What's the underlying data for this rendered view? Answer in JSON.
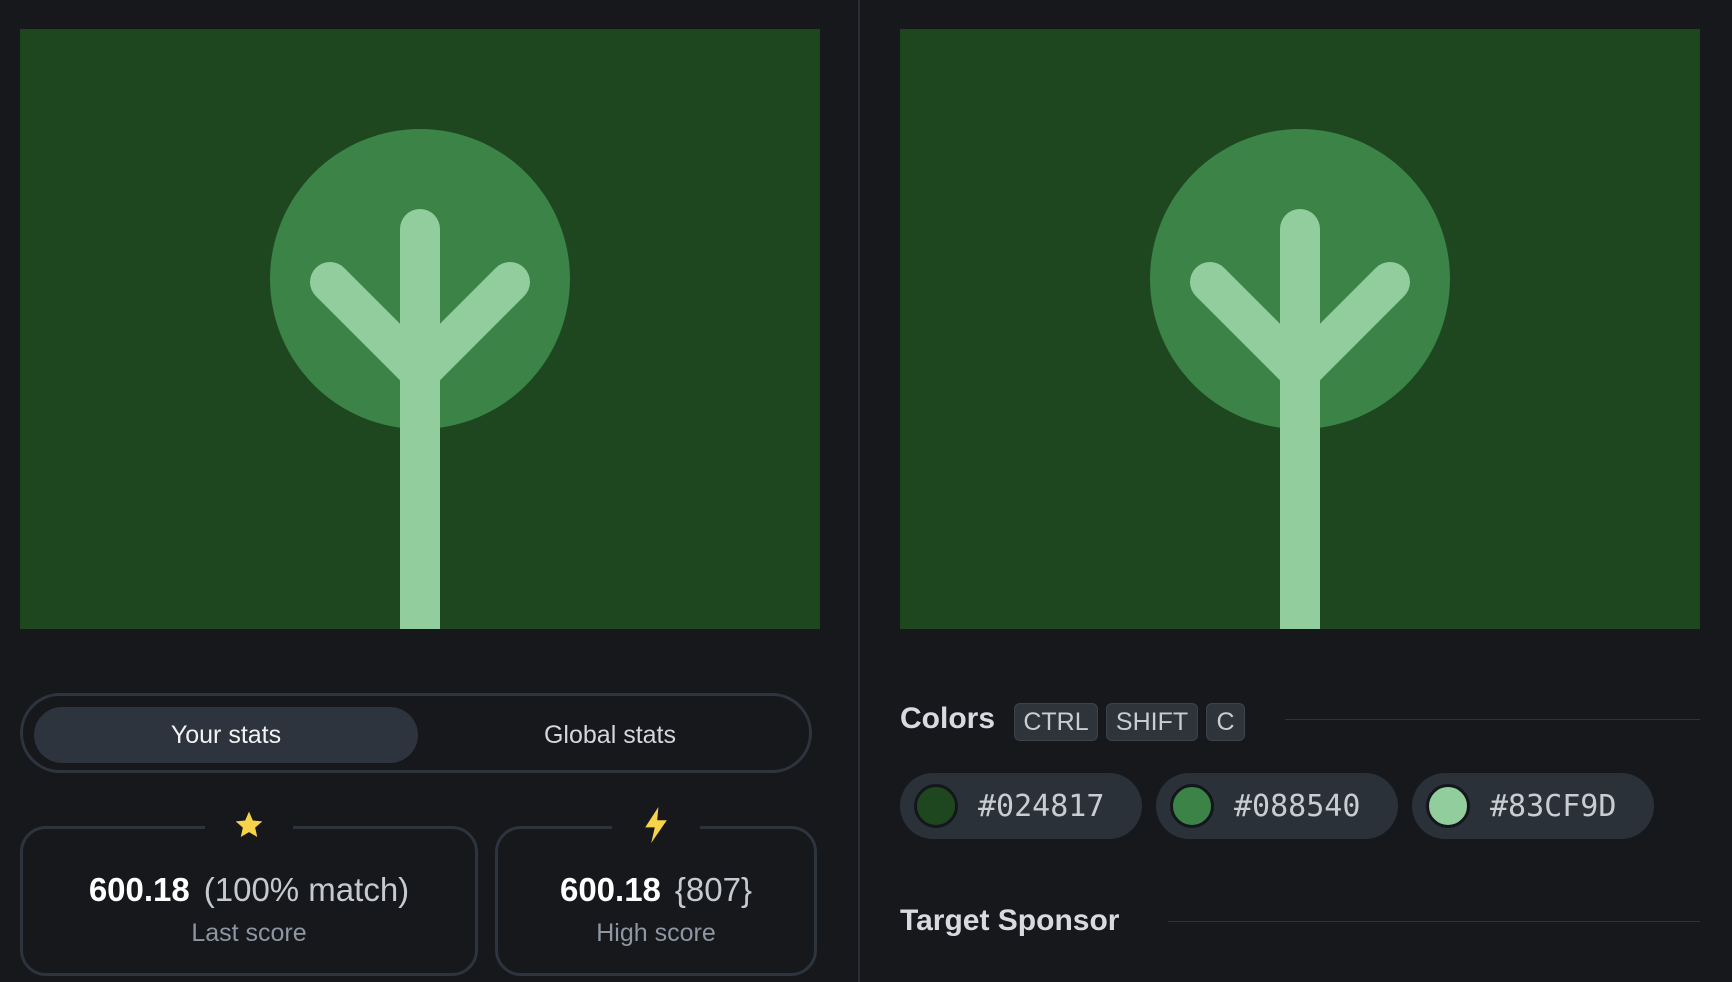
{
  "stats_toggle": {
    "your_stats": "Your stats",
    "global_stats": "Global stats"
  },
  "last_score": {
    "score": "600.18",
    "detail": "(100% match)",
    "label": "Last score",
    "icon": "star-icon"
  },
  "high_score": {
    "score": "600.18",
    "detail": "{807}",
    "label": "High score",
    "icon": "lightning-icon"
  },
  "colors": {
    "title": "Colors",
    "shortcut": [
      "CTRL",
      "SHIFT",
      "C"
    ],
    "palette": [
      {
        "hex": "#024817",
        "swatch": "#1e471f"
      },
      {
        "hex": "#088540",
        "swatch": "#3b8347"
      },
      {
        "hex": "#83CF9D",
        "swatch": "#92cd9e"
      }
    ]
  },
  "sponsor": {
    "title": "Target Sponsor"
  },
  "theme": {
    "background": "#16181c",
    "canvas_bg": "#1e471f",
    "circle": "#3b8347",
    "tree": "#92cd9e",
    "star": "#f6d34a"
  }
}
